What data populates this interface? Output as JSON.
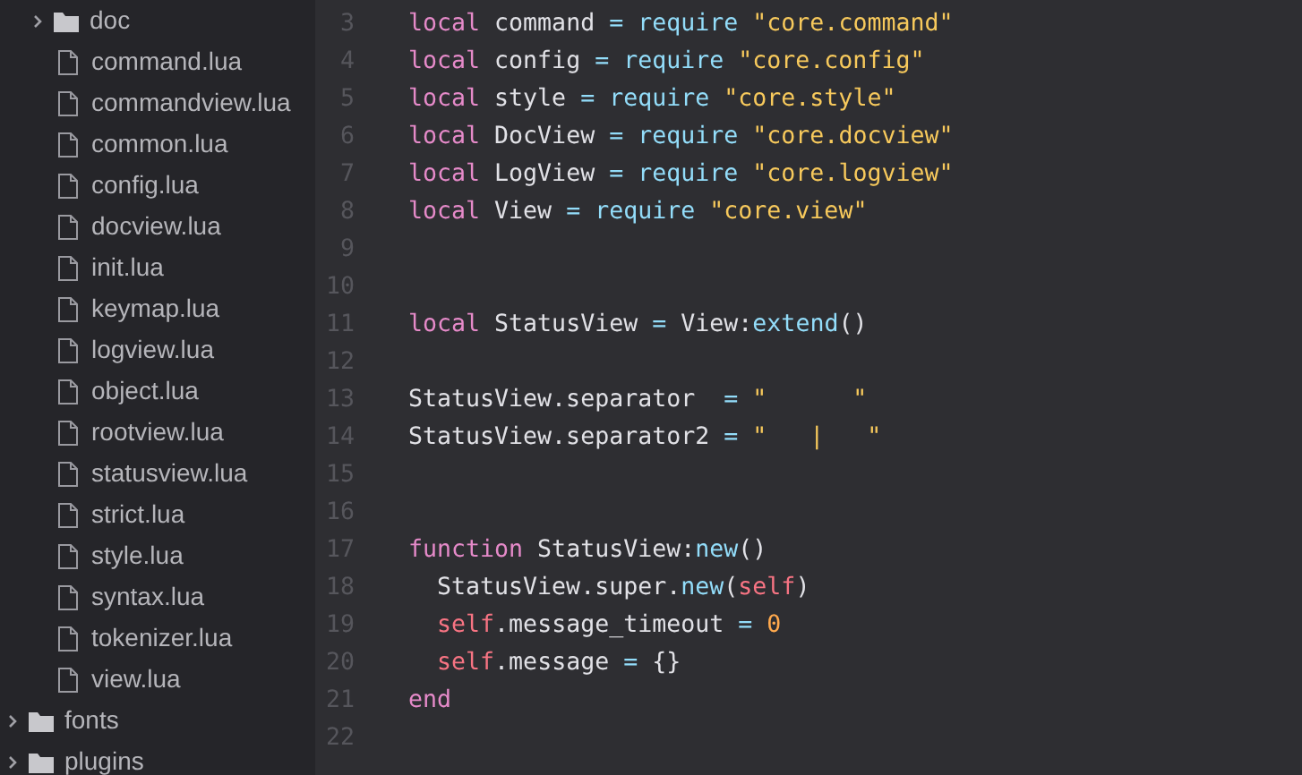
{
  "sidebar": {
    "tree": [
      {
        "children": [
          {
            "kind": "folder",
            "name": "doc",
            "expanded": false
          },
          {
            "kind": "file",
            "name": "command.lua"
          },
          {
            "kind": "file",
            "name": "commandview.lua"
          },
          {
            "kind": "file",
            "name": "common.lua"
          },
          {
            "kind": "file",
            "name": "config.lua"
          },
          {
            "kind": "file",
            "name": "docview.lua"
          },
          {
            "kind": "file",
            "name": "init.lua"
          },
          {
            "kind": "file",
            "name": "keymap.lua"
          },
          {
            "kind": "file",
            "name": "logview.lua"
          },
          {
            "kind": "file",
            "name": "object.lua"
          },
          {
            "kind": "file",
            "name": "rootview.lua"
          },
          {
            "kind": "file",
            "name": "statusview.lua"
          },
          {
            "kind": "file",
            "name": "strict.lua"
          },
          {
            "kind": "file",
            "name": "style.lua"
          },
          {
            "kind": "file",
            "name": "syntax.lua"
          },
          {
            "kind": "file",
            "name": "tokenizer.lua"
          },
          {
            "kind": "file",
            "name": "view.lua"
          }
        ]
      },
      {
        "kind": "folder",
        "name": "fonts",
        "expanded": false
      },
      {
        "kind": "folder",
        "name": "plugins",
        "expanded": false
      }
    ]
  },
  "editor": {
    "lines": [
      {
        "number": "3",
        "tokens": [
          {
            "kind": "keyword",
            "text": "local"
          },
          {
            "kind": "normal",
            "text": " command "
          },
          {
            "kind": "operator",
            "text": "= "
          },
          {
            "kind": "function",
            "text": "require "
          },
          {
            "kind": "string",
            "text": "\"core.command\""
          }
        ]
      },
      {
        "number": "4",
        "tokens": [
          {
            "kind": "keyword",
            "text": "local"
          },
          {
            "kind": "normal",
            "text": " config "
          },
          {
            "kind": "operator",
            "text": "= "
          },
          {
            "kind": "function",
            "text": "require "
          },
          {
            "kind": "string",
            "text": "\"core.config\""
          }
        ]
      },
      {
        "number": "5",
        "tokens": [
          {
            "kind": "keyword",
            "text": "local"
          },
          {
            "kind": "normal",
            "text": " style "
          },
          {
            "kind": "operator",
            "text": "= "
          },
          {
            "kind": "function",
            "text": "require "
          },
          {
            "kind": "string",
            "text": "\"core.style\""
          }
        ]
      },
      {
        "number": "6",
        "tokens": [
          {
            "kind": "keyword",
            "text": "local"
          },
          {
            "kind": "normal",
            "text": " DocView "
          },
          {
            "kind": "operator",
            "text": "= "
          },
          {
            "kind": "function",
            "text": "require "
          },
          {
            "kind": "string",
            "text": "\"core.docview\""
          }
        ]
      },
      {
        "number": "7",
        "tokens": [
          {
            "kind": "keyword",
            "text": "local"
          },
          {
            "kind": "normal",
            "text": " LogView "
          },
          {
            "kind": "operator",
            "text": "= "
          },
          {
            "kind": "function",
            "text": "require "
          },
          {
            "kind": "string",
            "text": "\"core.logview\""
          }
        ]
      },
      {
        "number": "8",
        "tokens": [
          {
            "kind": "keyword",
            "text": "local"
          },
          {
            "kind": "normal",
            "text": " View "
          },
          {
            "kind": "operator",
            "text": "= "
          },
          {
            "kind": "function",
            "text": "require "
          },
          {
            "kind": "string",
            "text": "\"core.view\""
          }
        ]
      },
      {
        "number": "9"
      },
      {
        "number": "10"
      },
      {
        "number": "11",
        "tokens": [
          {
            "kind": "keyword",
            "text": "local"
          },
          {
            "kind": "normal",
            "text": " StatusView "
          },
          {
            "kind": "operator",
            "text": "="
          },
          {
            "kind": "normal",
            "text": " View:"
          },
          {
            "kind": "function",
            "text": "extend"
          },
          {
            "kind": "normal",
            "text": "()"
          }
        ]
      },
      {
        "number": "12"
      },
      {
        "number": "13",
        "tokens": [
          {
            "kind": "normal",
            "text": "StatusView.separator  "
          },
          {
            "kind": "operator",
            "text": "= "
          },
          {
            "kind": "string",
            "text": "\"      \""
          }
        ]
      },
      {
        "number": "14",
        "tokens": [
          {
            "kind": "normal",
            "text": "StatusView.separator2 "
          },
          {
            "kind": "operator",
            "text": "= "
          },
          {
            "kind": "string",
            "text": "\"   |   \""
          }
        ]
      },
      {
        "number": "15"
      },
      {
        "number": "16"
      },
      {
        "number": "17",
        "tokens": [
          {
            "kind": "keyword",
            "text": "function"
          },
          {
            "kind": "normal",
            "text": " StatusView:"
          },
          {
            "kind": "function",
            "text": "new"
          },
          {
            "kind": "normal",
            "text": "()"
          }
        ]
      },
      {
        "number": "18",
        "tokens": [
          {
            "kind": "normal",
            "text": "  StatusView.super."
          },
          {
            "kind": "function",
            "text": "new"
          },
          {
            "kind": "normal",
            "text": "("
          },
          {
            "kind": "keyword2",
            "text": "self"
          },
          {
            "kind": "normal",
            "text": ")"
          }
        ]
      },
      {
        "number": "19",
        "tokens": [
          {
            "kind": "keyword2",
            "text": "  self"
          },
          {
            "kind": "normal",
            "text": ".message_timeout "
          },
          {
            "kind": "operator",
            "text": "= "
          },
          {
            "kind": "number",
            "text": "0"
          }
        ]
      },
      {
        "number": "20",
        "tokens": [
          {
            "kind": "keyword2",
            "text": "  self"
          },
          {
            "kind": "normal",
            "text": ".message "
          },
          {
            "kind": "operator",
            "text": "="
          },
          {
            "kind": "normal",
            "text": " {}"
          }
        ]
      },
      {
        "number": "21",
        "tokens": [
          {
            "kind": "keyword",
            "text": "end"
          }
        ]
      },
      {
        "number": "22"
      }
    ]
  }
}
